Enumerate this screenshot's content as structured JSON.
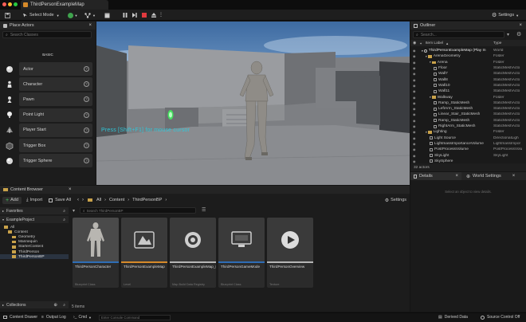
{
  "window": {
    "tab_title": "ThirdPersonExampleMap"
  },
  "toolbar": {
    "mode_label": "Select Mode",
    "settings_label": "Settings"
  },
  "place_actors": {
    "title": "Place Actors",
    "search_placeholder": "Search Classes",
    "category": "BASIC",
    "items": [
      {
        "label": "Actor",
        "icon": "sphere-icon"
      },
      {
        "label": "Character",
        "icon": "character-icon"
      },
      {
        "label": "Pawn",
        "icon": "pawn-icon"
      },
      {
        "label": "Point Light",
        "icon": "light-bulb-icon"
      },
      {
        "label": "Player Start",
        "icon": "player-start-icon"
      },
      {
        "label": "Trigger Box",
        "icon": "box-icon"
      },
      {
        "label": "Trigger Sphere",
        "icon": "sphere-icon"
      }
    ]
  },
  "viewport": {
    "debug_text": "Press [Shift+F1] for mouse cursor"
  },
  "outliner": {
    "title": "Outliner",
    "search_placeholder": "Search...",
    "col_label": "Item Label",
    "col_type": "Type",
    "rows": [
      {
        "label": "ThirdPersonExampleMap (Play In",
        "type": "World",
        "depth": 0
      },
      {
        "label": "ArenaGeometry",
        "type": "Folder",
        "depth": 1
      },
      {
        "label": "Arena",
        "type": "Folder",
        "depth": 2
      },
      {
        "label": "Floor",
        "type": "StaticMeshActo",
        "depth": 3
      },
      {
        "label": "Wall7",
        "type": "StaticMeshActo",
        "depth": 3
      },
      {
        "label": "Wall8",
        "type": "StaticMeshActo",
        "depth": 3
      },
      {
        "label": "Wall10",
        "type": "StaticMeshActo",
        "depth": 3
      },
      {
        "label": "Wall11",
        "type": "StaticMeshActo",
        "depth": 3
      },
      {
        "label": "Walkway",
        "type": "Folder",
        "depth": 2
      },
      {
        "label": "Ramp_StaticMesh",
        "type": "StaticMeshActo",
        "depth": 3
      },
      {
        "label": "LeftArm_StaticMesh",
        "type": "StaticMeshActo",
        "depth": 3
      },
      {
        "label": "Linear_Stair_StaticMesh",
        "type": "StaticMeshActo",
        "depth": 3
      },
      {
        "label": "Ramp_StaticMesh",
        "type": "StaticMeshActo",
        "depth": 3
      },
      {
        "label": "RightArm_StaticMesh",
        "type": "StaticMeshActo",
        "depth": 3
      },
      {
        "label": "Lighting",
        "type": "Folder",
        "depth": 1
      },
      {
        "label": "Light Source",
        "type": "DirectionalLigh",
        "depth": 2
      },
      {
        "label": "LightmassImportanceVolume",
        "type": "LightmassImpor",
        "depth": 2
      },
      {
        "label": "PostProcessVolume",
        "type": "PostProcessVolu",
        "depth": 2
      },
      {
        "label": "SkyLight",
        "type": "SkyLight",
        "depth": 2
      },
      {
        "label": "SkySphere",
        "type": "",
        "depth": 2
      }
    ],
    "count": "32 actors"
  },
  "details": {
    "title": "Details",
    "world_settings": "World Settings",
    "empty_text": "Select an object to view details."
  },
  "content_browser": {
    "title": "Content Browser",
    "add_label": "Add",
    "import_label": "Import",
    "save_all_label": "Save All",
    "breadcrumb": [
      "All",
      "Content",
      "ThirdPersonBP"
    ],
    "settings_label": "Settings",
    "favorites_label": "Favorites",
    "project_label": "ExampleProject",
    "tree": [
      "All",
      "Content",
      "Geometry",
      "Mannequin",
      "StarterContent",
      "ThirdPerson",
      "ThirdPersonBP"
    ],
    "search_placeholder": "Search ThirdPersonBP",
    "collections_label": "Collections",
    "items_count": "5 items",
    "assets": [
      {
        "name": "ThirdPersonCharacter",
        "type": "Blueprint Class",
        "color": "#2f6db5"
      },
      {
        "name": "ThirdPersonExampleMap",
        "type": "Level",
        "color": "#d68a2a"
      },
      {
        "name": "ThirdPersonExampleMap_BuiltData",
        "type": "Map Build Data Registry",
        "color": "#b5b5b5"
      },
      {
        "name": "ThirdPersonGameMode",
        "type": "Blueprint Class",
        "color": "#2f6db5"
      },
      {
        "name": "ThirdPersonOverview",
        "type": "Texture",
        "color": "#b5b5b5"
      }
    ]
  },
  "statusbar": {
    "content_drawer": "Content Drawer",
    "output_log": "Output Log",
    "cmd_label": "Cmd",
    "console_placeholder": "Enter Console Command",
    "derived_data": "Derived Data",
    "source_control": "Source Control Off"
  },
  "colors": {
    "accent": "#2f6db5",
    "bg": "#151515",
    "panel": "#1c1c1c"
  }
}
